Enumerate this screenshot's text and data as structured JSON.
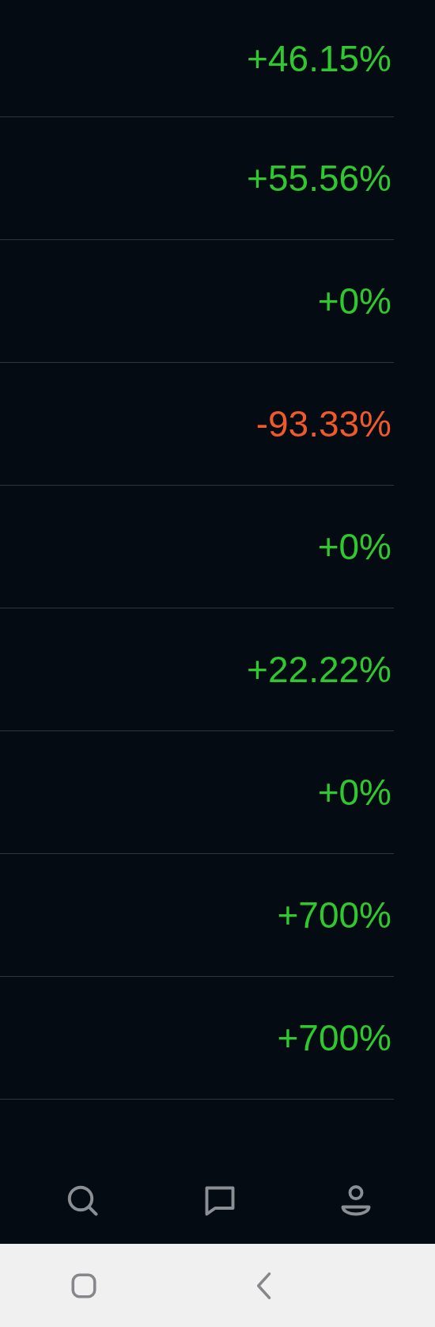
{
  "changes": [
    {
      "value": "+46.15%",
      "kind": "gain"
    },
    {
      "value": "+55.56%",
      "kind": "gain"
    },
    {
      "value": "+0%",
      "kind": "gain"
    },
    {
      "value": "-93.33%",
      "kind": "loss"
    },
    {
      "value": "+0%",
      "kind": "gain"
    },
    {
      "value": "+22.22%",
      "kind": "gain"
    },
    {
      "value": "+0%",
      "kind": "gain"
    },
    {
      "value": "+700%",
      "kind": "gain"
    },
    {
      "value": "+700%",
      "kind": "gain"
    }
  ],
  "bottom_nav": [
    {
      "kind": "search"
    },
    {
      "kind": "chat"
    },
    {
      "kind": "profile"
    }
  ],
  "system_nav": [
    {
      "kind": "recents"
    },
    {
      "kind": "back"
    }
  ]
}
